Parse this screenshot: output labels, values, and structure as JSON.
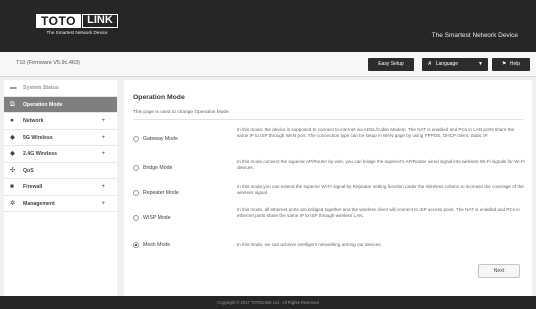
{
  "header": {
    "logo_left": "TOTO",
    "logo_right": "LINK",
    "logo_tagline": "The Smartest Network Device",
    "tagline": "The Smartest Network Device"
  },
  "topbar": {
    "firmware": "T10 (Firmware V5.9c.463)",
    "easy_setup": "Easy Setup",
    "language": "Language",
    "help": "Help"
  },
  "sidebar": {
    "items": [
      {
        "label": "System Status",
        "icon": "monitor-icon",
        "expandable": false,
        "state": "muted"
      },
      {
        "label": "Operation Mode",
        "icon": "mode-icon",
        "expandable": false,
        "state": "active"
      },
      {
        "label": "Network",
        "icon": "globe-icon",
        "expandable": true,
        "state": "normal"
      },
      {
        "label": "5G Wireless",
        "icon": "wifi-icon",
        "expandable": true,
        "state": "normal"
      },
      {
        "label": "2.4G Wireless",
        "icon": "wifi-icon",
        "expandable": true,
        "state": "normal"
      },
      {
        "label": "QoS",
        "icon": "qos-icon",
        "expandable": false,
        "state": "normal"
      },
      {
        "label": "Firewall",
        "icon": "lock-icon",
        "expandable": true,
        "state": "normal"
      },
      {
        "label": "Management",
        "icon": "gear-icon",
        "expandable": true,
        "state": "normal"
      }
    ]
  },
  "main": {
    "title": "Operation Mode",
    "description": "This page is used to change Operation Mode.",
    "modes": [
      {
        "label": "Gateway Mode",
        "checked": false,
        "description": "In this mode, the device is supposed to connect to internet via ADSL/Cable Modem. The NAT is enabled and PCs in LAN ports share the same IP to ISP through WAN port. The connection type can be setup in WAN page by using PPPOE, DHCP client, Static IP."
      },
      {
        "label": "Bridge Mode",
        "checked": false,
        "description": "In this mode,connect the superior AP/Router by wire, you can bridge the superior's AP/Router wired signal into wireless Wi-Fi signals for Wi-Fi devices."
      },
      {
        "label": "Repeater Mode",
        "checked": false,
        "description": "In this mode,you can extend the superior Wi-Fi signal by Repeater setting function under the Wireless column to increase the coverage of the wireless signal."
      },
      {
        "label": "WISP Mode",
        "checked": false,
        "description": "In this mode, all ethernet ports are bridged together and the wireless client will connect to ISP access point. The NAT is enabled and PCs in ethernet ports share the same IP to ISP through wireless LAN."
      },
      {
        "label": "Mesh Mode",
        "checked": true,
        "description": "In this mode, we can achieve intelligent networking among our devices."
      }
    ],
    "next": "Next"
  },
  "footer": {
    "copyright": "Copyright © 2017 TOTOLINK Ltd.,  All Rights Reserved"
  },
  "colors": {
    "header_bg": "#262626",
    "active_nav": "#7f7f7f",
    "page_bg": "#efefef"
  }
}
